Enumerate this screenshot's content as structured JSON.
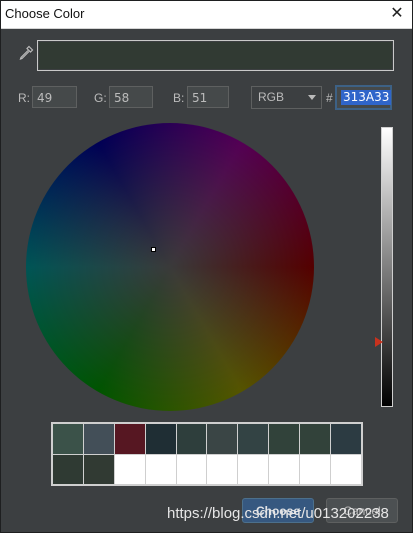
{
  "window": {
    "title": "Choose Color",
    "close_glyph": "✕"
  },
  "picker": {
    "eyedropper_icon": "eyedropper-icon",
    "preview_color": "#313A33"
  },
  "rgb": {
    "r_label": "R:",
    "r_value": "49",
    "g_label": "G:",
    "g_value": "58",
    "b_label": "B:",
    "b_value": "51"
  },
  "mode": {
    "selected": "RGB"
  },
  "hex": {
    "prefix": "#",
    "value": "313A33"
  },
  "swatches": {
    "colors": [
      "#3b5249",
      "#434f58",
      "#561722",
      "#1f2e34",
      "#2e3e3c",
      "#3a4545",
      "#334344",
      "#31423a",
      "#32423a",
      "#2c3b42",
      "#2f3a33",
      "#313a33",
      "#ffffff",
      "#ffffff",
      "#ffffff",
      "#ffffff",
      "#ffffff",
      "#ffffff",
      "#ffffff",
      "#ffffff"
    ]
  },
  "buttons": {
    "choose_label": "Choose",
    "cancel_label": "Cancel"
  },
  "watermark": "https://blog.csdn.net/u013202238"
}
